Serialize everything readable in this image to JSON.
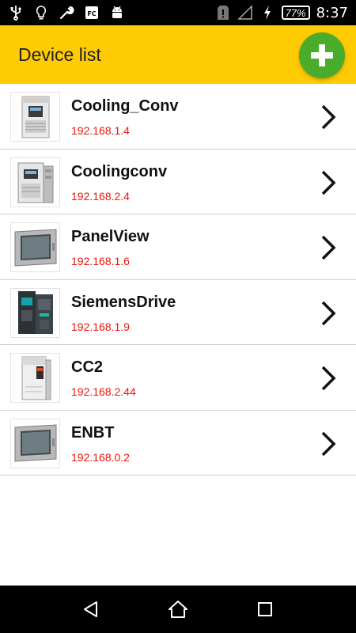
{
  "status_bar": {
    "icons": [
      "usb-icon",
      "lightbulb-icon",
      "wrench-icon",
      "fc-icon",
      "android-icon",
      "sim-alert-icon",
      "signal-icon",
      "charging-icon"
    ],
    "battery": "77%",
    "time": "8:37"
  },
  "app_bar": {
    "title": "Device list",
    "add_icon": "plus-icon",
    "accent_color": "#FFCB05",
    "add_button_color": "#49AC2B"
  },
  "devices": [
    {
      "name": "Cooling_Conv",
      "ip": "192.168.1.4",
      "image": "drive-unit-image"
    },
    {
      "name": "Coolingconv",
      "ip": "192.168.2.4",
      "image": "drive-unit-image"
    },
    {
      "name": "PanelView",
      "ip": "192.168.1.6",
      "image": "hmi-panel-image"
    },
    {
      "name": "SiemensDrive",
      "ip": "192.168.1.9",
      "image": "siemens-drive-image"
    },
    {
      "name": "CC2",
      "ip": "192.168.2.44",
      "image": "cabinet-drive-image"
    },
    {
      "name": "ENBT",
      "ip": "192.168.0.2",
      "image": "hmi-panel-image"
    }
  ],
  "ip_color": "#E8160C",
  "nav_bar": {
    "back": "back-icon",
    "home": "home-icon",
    "recents": "recents-icon"
  }
}
